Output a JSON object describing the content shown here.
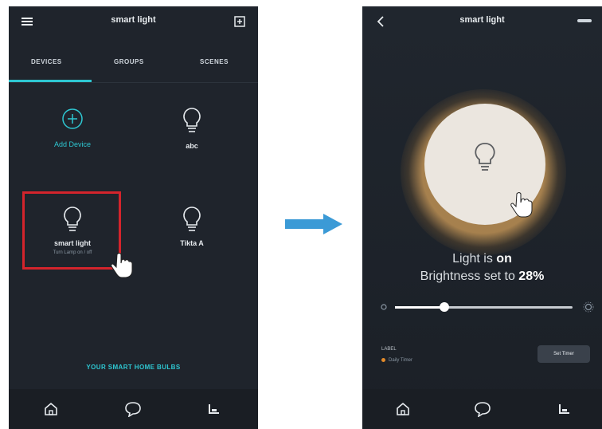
{
  "left_screen": {
    "title": "smart light",
    "tabs": [
      "DEVICES",
      "GROUPS",
      "SCENES"
    ],
    "tiles": [
      {
        "label": "Add Device",
        "sub": ""
      },
      {
        "label": "abc",
        "sub": ""
      },
      {
        "label": "smart light",
        "sub": "Turn Lamp on / off"
      },
      {
        "label": "Tikta A",
        "sub": ""
      }
    ],
    "footer_link": "YOUR SMART HOME BULBS"
  },
  "right_screen": {
    "title": "smart light",
    "light_prefix": "Light is",
    "light_state": "on",
    "brightness_prefix": "Brightness set to",
    "brightness_value": "28%",
    "brightness_fraction": 0.28,
    "schedule_title": "LABEL",
    "schedule_sub": "Daily Timer",
    "set_button": "Set Timer"
  },
  "colors": {
    "accent": "#2ec7d2",
    "highlight": "#d3242c",
    "arrow": "#3b9ad6"
  },
  "icons": [
    "menu-icon",
    "add-icon",
    "back-icon",
    "settings-icon",
    "bulb-icon",
    "home-icon",
    "chat-icon",
    "profile-icon",
    "arrow-right-icon",
    "pointer-hand-icon"
  ]
}
